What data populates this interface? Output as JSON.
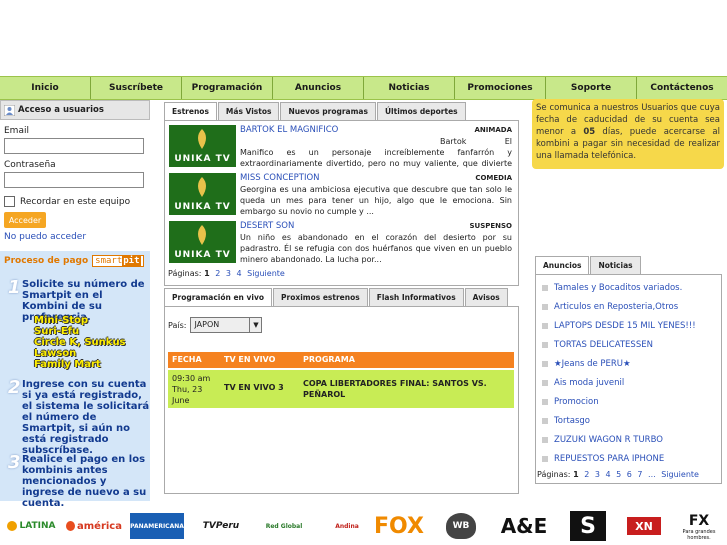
{
  "nav": [
    "Inicio",
    "Suscríbete",
    "Programación",
    "Anuncios",
    "Noticias",
    "Promociones",
    "Soporte",
    "Contáctenos"
  ],
  "login": {
    "title": "Acceso a usuarios",
    "email_label": "Email",
    "password_label": "Contraseña",
    "remember_label": "Recordar en este equipo",
    "submit_label": "Acceder",
    "forgot_label": "No puedo acceder"
  },
  "smartpit": {
    "title": "Proceso de pago",
    "logo_a": "smart",
    "logo_b": "pit",
    "step1": "Solicite su número de Smartpit en el Kombini de su preferencia.",
    "stores": [
      "Mini-Stop",
      "Suri-Efu",
      "Circle K, Sunkus",
      "Lawson",
      "Family Mart"
    ],
    "step2": "Ingrese con su cuenta si ya está registrado, el sistema le solicitará el número de Smartpit, si aún no está registrado subscríbase.",
    "step3": "Realice el pago en los kombinis antes mencionados y ingrese de  nuevo a su cuenta.",
    "num1": "1",
    "num2": "2",
    "num3": "3"
  },
  "movies_tabs": [
    "Estrenos",
    "Más Vistos",
    "Nuevos programas",
    "Últimos deportes"
  ],
  "movies": [
    {
      "title": "BARTOK EL MAGNIFICO",
      "genre": "ANIMADA",
      "logo": "UNIKA TV",
      "desc": "Bartok El Manifico es un personaje increíblemente fanfarrón y extraordinariamente divertido, pero no muy valiente, que divierte con sus \"fingidos\" actos..."
    },
    {
      "title": "MISS CONCEPTION",
      "genre": "COMEDIA",
      "logo": "UNIKA TV",
      "desc": "Georgina es una ambiciosa ejecutiva que descubre que tan solo le queda un mes para tener un hijo, algo que le emociona. Sin embargo su novio no cumple y ..."
    },
    {
      "title": "DESERT SON",
      "genre": "SUSPENSO",
      "logo": "UNIKA TV",
      "desc": "Un niño es abandonado en el corazón del desierto por su padrastro. Él se refugia con dos huérfanos que viven en un pueblo minero abandonado. La lucha por..."
    }
  ],
  "movies_pages": {
    "label": "Páginas:",
    "current": "1",
    "others": [
      "2",
      "3",
      "4"
    ],
    "next": "Siguiente"
  },
  "live_tabs": [
    "Programación en vivo",
    "Proximos estrenos",
    "Flash Informativos",
    "Avisos"
  ],
  "live": {
    "country_label": "País:",
    "country_value": "JAPON",
    "headers": [
      "FECHA",
      "TV EN VIVO",
      "PROGRAMA"
    ],
    "row": {
      "date": "09:30 am Thu, 23 June",
      "channel": "TV EN VIVO 3",
      "program": "COPA LIBERTADORES FINAL: SANTOS VS. PEÑAROL"
    }
  },
  "notice": {
    "pre": "Se comunica a nuestros Usuarios que cuya fecha de caducidad de su cuenta sea menor a ",
    "bold": "05",
    "post": " días, puede acercarse al kombini a pagar sin necesidad de realizar una llamada telefónica."
  },
  "ads_tabs": [
    "Anuncios",
    "Noticias"
  ],
  "ads": [
    "Tamales y Bocaditos variados.",
    "Articulos en Reposteria,Otros",
    "LAPTOPS DESDE 15 MIL YENES!!!",
    "TORTAS DELICATESSEN",
    "★Jeans de PERU★",
    "Ais moda juvenil",
    "Promocion",
    "Tortasgo",
    "ZUZUKI WAGON R TURBO",
    "REPUESTOS PARA IPHONE"
  ],
  "ads_pages": {
    "label": "Páginas:",
    "current": "1",
    "others": [
      "2",
      "3",
      "4",
      "5",
      "6",
      "7",
      "..."
    ],
    "next": "Siguiente"
  },
  "channels": [
    "LATINA",
    "américa",
    "PANAMERICANA",
    "TVPeru",
    "Red Global",
    "Andina",
    "FOX",
    "WB",
    "A&E",
    "S",
    "XN",
    "FX"
  ],
  "fx_tagline": "Para grandes hombres.",
  "colors": {
    "nav": "#c8e88a",
    "notice": "#f6d84a",
    "table_head": "#f58220",
    "table_row": "#c8ec55",
    "sidebar": "#d4e6f8"
  }
}
